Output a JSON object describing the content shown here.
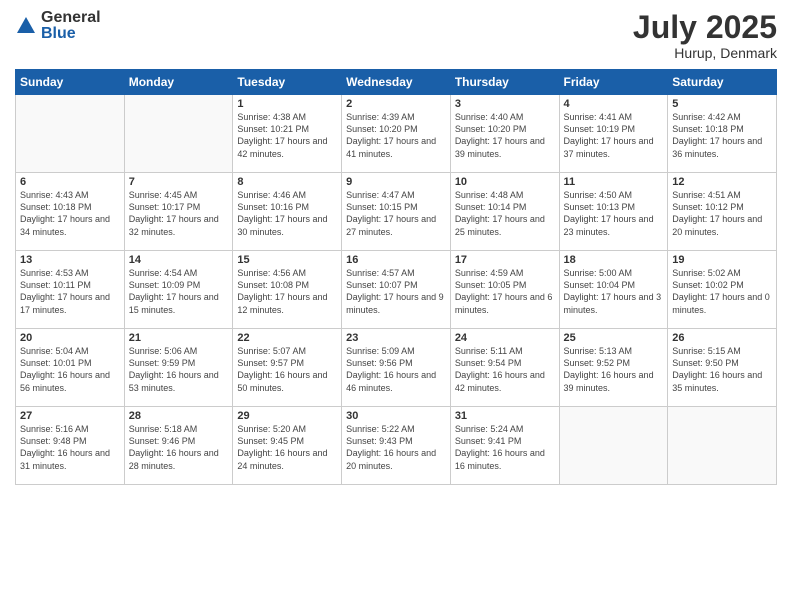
{
  "logo": {
    "general": "General",
    "blue": "Blue"
  },
  "header": {
    "month": "July 2025",
    "location": "Hurup, Denmark"
  },
  "weekdays": [
    "Sunday",
    "Monday",
    "Tuesday",
    "Wednesday",
    "Thursday",
    "Friday",
    "Saturday"
  ],
  "weeks": [
    [
      {
        "day": "",
        "info": ""
      },
      {
        "day": "",
        "info": ""
      },
      {
        "day": "1",
        "info": "Sunrise: 4:38 AM\nSunset: 10:21 PM\nDaylight: 17 hours\nand 42 minutes."
      },
      {
        "day": "2",
        "info": "Sunrise: 4:39 AM\nSunset: 10:20 PM\nDaylight: 17 hours\nand 41 minutes."
      },
      {
        "day": "3",
        "info": "Sunrise: 4:40 AM\nSunset: 10:20 PM\nDaylight: 17 hours\nand 39 minutes."
      },
      {
        "day": "4",
        "info": "Sunrise: 4:41 AM\nSunset: 10:19 PM\nDaylight: 17 hours\nand 37 minutes."
      },
      {
        "day": "5",
        "info": "Sunrise: 4:42 AM\nSunset: 10:18 PM\nDaylight: 17 hours\nand 36 minutes."
      }
    ],
    [
      {
        "day": "6",
        "info": "Sunrise: 4:43 AM\nSunset: 10:18 PM\nDaylight: 17 hours\nand 34 minutes."
      },
      {
        "day": "7",
        "info": "Sunrise: 4:45 AM\nSunset: 10:17 PM\nDaylight: 17 hours\nand 32 minutes."
      },
      {
        "day": "8",
        "info": "Sunrise: 4:46 AM\nSunset: 10:16 PM\nDaylight: 17 hours\nand 30 minutes."
      },
      {
        "day": "9",
        "info": "Sunrise: 4:47 AM\nSunset: 10:15 PM\nDaylight: 17 hours\nand 27 minutes."
      },
      {
        "day": "10",
        "info": "Sunrise: 4:48 AM\nSunset: 10:14 PM\nDaylight: 17 hours\nand 25 minutes."
      },
      {
        "day": "11",
        "info": "Sunrise: 4:50 AM\nSunset: 10:13 PM\nDaylight: 17 hours\nand 23 minutes."
      },
      {
        "day": "12",
        "info": "Sunrise: 4:51 AM\nSunset: 10:12 PM\nDaylight: 17 hours\nand 20 minutes."
      }
    ],
    [
      {
        "day": "13",
        "info": "Sunrise: 4:53 AM\nSunset: 10:11 PM\nDaylight: 17 hours\nand 17 minutes."
      },
      {
        "day": "14",
        "info": "Sunrise: 4:54 AM\nSunset: 10:09 PM\nDaylight: 17 hours\nand 15 minutes."
      },
      {
        "day": "15",
        "info": "Sunrise: 4:56 AM\nSunset: 10:08 PM\nDaylight: 17 hours\nand 12 minutes."
      },
      {
        "day": "16",
        "info": "Sunrise: 4:57 AM\nSunset: 10:07 PM\nDaylight: 17 hours\nand 9 minutes."
      },
      {
        "day": "17",
        "info": "Sunrise: 4:59 AM\nSunset: 10:05 PM\nDaylight: 17 hours\nand 6 minutes."
      },
      {
        "day": "18",
        "info": "Sunrise: 5:00 AM\nSunset: 10:04 PM\nDaylight: 17 hours\nand 3 minutes."
      },
      {
        "day": "19",
        "info": "Sunrise: 5:02 AM\nSunset: 10:02 PM\nDaylight: 17 hours\nand 0 minutes."
      }
    ],
    [
      {
        "day": "20",
        "info": "Sunrise: 5:04 AM\nSunset: 10:01 PM\nDaylight: 16 hours\nand 56 minutes."
      },
      {
        "day": "21",
        "info": "Sunrise: 5:06 AM\nSunset: 9:59 PM\nDaylight: 16 hours\nand 53 minutes."
      },
      {
        "day": "22",
        "info": "Sunrise: 5:07 AM\nSunset: 9:57 PM\nDaylight: 16 hours\nand 50 minutes."
      },
      {
        "day": "23",
        "info": "Sunrise: 5:09 AM\nSunset: 9:56 PM\nDaylight: 16 hours\nand 46 minutes."
      },
      {
        "day": "24",
        "info": "Sunrise: 5:11 AM\nSunset: 9:54 PM\nDaylight: 16 hours\nand 42 minutes."
      },
      {
        "day": "25",
        "info": "Sunrise: 5:13 AM\nSunset: 9:52 PM\nDaylight: 16 hours\nand 39 minutes."
      },
      {
        "day": "26",
        "info": "Sunrise: 5:15 AM\nSunset: 9:50 PM\nDaylight: 16 hours\nand 35 minutes."
      }
    ],
    [
      {
        "day": "27",
        "info": "Sunrise: 5:16 AM\nSunset: 9:48 PM\nDaylight: 16 hours\nand 31 minutes."
      },
      {
        "day": "28",
        "info": "Sunrise: 5:18 AM\nSunset: 9:46 PM\nDaylight: 16 hours\nand 28 minutes."
      },
      {
        "day": "29",
        "info": "Sunrise: 5:20 AM\nSunset: 9:45 PM\nDaylight: 16 hours\nand 24 minutes."
      },
      {
        "day": "30",
        "info": "Sunrise: 5:22 AM\nSunset: 9:43 PM\nDaylight: 16 hours\nand 20 minutes."
      },
      {
        "day": "31",
        "info": "Sunrise: 5:24 AM\nSunset: 9:41 PM\nDaylight: 16 hours\nand 16 minutes."
      },
      {
        "day": "",
        "info": ""
      },
      {
        "day": "",
        "info": ""
      }
    ]
  ]
}
